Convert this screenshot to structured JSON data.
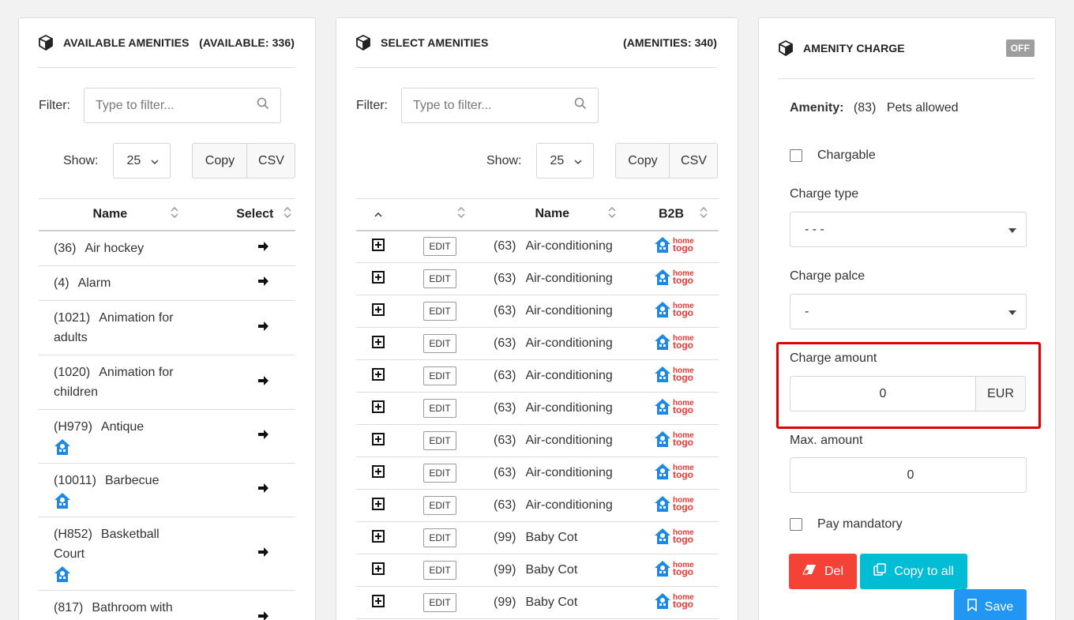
{
  "available": {
    "title": "AVAILABLE AMENITIES",
    "count": "(AVAILABLE: 336)",
    "filter_label": "Filter:",
    "filter_placeholder": "Type to filter...",
    "show_label": "Show:",
    "show_value": "25",
    "copy_label": "Copy",
    "csv_label": "CSV",
    "col_name": "Name",
    "col_select": "Select",
    "rows": [
      {
        "num": "(36)",
        "name": "Air hockey",
        "icon": false
      },
      {
        "num": "(4)",
        "name": "Alarm",
        "icon": false
      },
      {
        "num": "(1021)",
        "name": "Animation for adults",
        "icon": false
      },
      {
        "num": "(1020)",
        "name": "Animation for children",
        "icon": false
      },
      {
        "num": "(H979)",
        "name": "Antique",
        "icon": true
      },
      {
        "num": "(10011)",
        "name": "Barbecue",
        "icon": true
      },
      {
        "num": "(H852)",
        "name": "Basketball Court",
        "icon": true
      },
      {
        "num": "(817)",
        "name": "Bathroom with shower",
        "icon": false
      }
    ]
  },
  "selected": {
    "title": "SELECT AMENITIES",
    "count": "(AMENITIES: 340)",
    "filter_label": "Filter:",
    "filter_placeholder": "Type to filter...",
    "show_label": "Show:",
    "show_value": "25",
    "copy_label": "Copy",
    "csv_label": "CSV",
    "col_name": "Name",
    "col_b2b": "B2B",
    "edit_label": "EDIT",
    "logo_text_top": "home",
    "logo_text_bottom": "togo",
    "rows": [
      {
        "num": "(63)",
        "name": "Air-conditioning"
      },
      {
        "num": "(63)",
        "name": "Air-conditioning"
      },
      {
        "num": "(63)",
        "name": "Air-conditioning"
      },
      {
        "num": "(63)",
        "name": "Air-conditioning"
      },
      {
        "num": "(63)",
        "name": "Air-conditioning"
      },
      {
        "num": "(63)",
        "name": "Air-conditioning"
      },
      {
        "num": "(63)",
        "name": "Air-conditioning"
      },
      {
        "num": "(63)",
        "name": "Air-conditioning"
      },
      {
        "num": "(63)",
        "name": "Air-conditioning"
      },
      {
        "num": "(99)",
        "name": "Baby Cot"
      },
      {
        "num": "(99)",
        "name": "Baby Cot"
      },
      {
        "num": "(99)",
        "name": "Baby Cot"
      }
    ]
  },
  "charge": {
    "title": "AMENITY CHARGE",
    "toggle": "OFF",
    "amenity_label": "Amenity:",
    "amenity_num": "(83)",
    "amenity_name": "Pets allowed",
    "chargable_label": "Chargable",
    "charge_type_label": "Charge type",
    "charge_type_value": "- - -",
    "charge_place_label": "Charge palce",
    "charge_place_value": "-",
    "charge_amount_label": "Charge amount",
    "charge_amount_value": "0",
    "currency": "EUR",
    "max_amount_label": "Max. amount",
    "max_amount_value": "0",
    "pay_mandatory_label": "Pay mandatory",
    "del_label": "Del",
    "copy_all_label": "Copy to all",
    "save_label": "Save",
    "colors": {
      "del": "#f44336",
      "copy_all": "#00bcd4",
      "save": "#2196f3",
      "highlight": "#e00000"
    }
  }
}
